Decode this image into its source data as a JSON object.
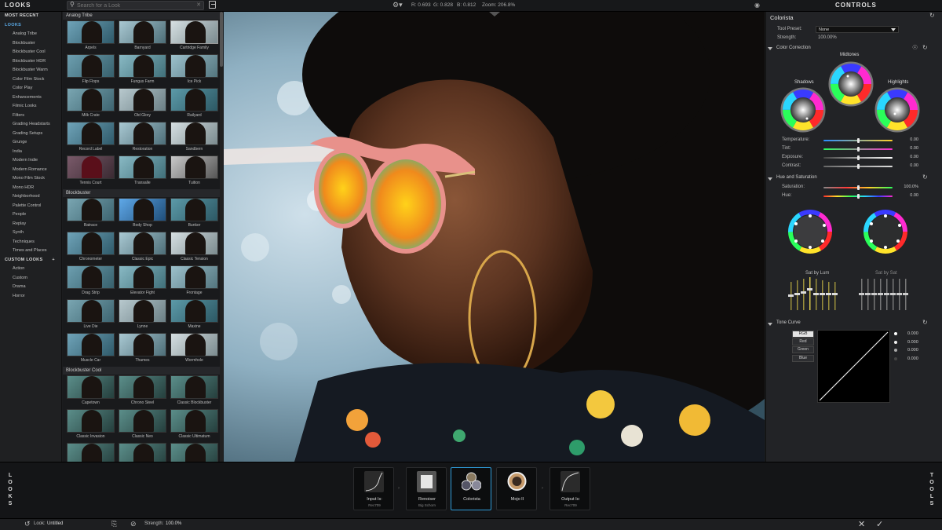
{
  "topbar": {
    "looks_title": "LOOKS",
    "search_placeholder": "Search for a Look",
    "readout_r": "R: 0.693",
    "readout_g": "G: 0.828",
    "readout_b": "B: 0.812",
    "zoom": "Zoom: 206.8%",
    "controls_title": "CONTROLS"
  },
  "sidebar": {
    "sections": [
      {
        "label": "MOST RECENT",
        "active": false,
        "items": []
      },
      {
        "label": "LOOKS",
        "active": true,
        "items": [
          "Analog Tribe",
          "Blockbuster",
          "Blockbuster Cool",
          "Blockbuster HDR",
          "Blockbuster Warm",
          "Color Film Stock",
          "Color Play",
          "Enhancements",
          "Filmic Looks",
          "Filters",
          "Grading Headstarts",
          "Grading Setups",
          "Grunge",
          "India",
          "Modern Indie",
          "Modern Romance",
          "Mono Film Stock",
          "Mono HDR",
          "Neighborhood",
          "Palette Control",
          "People",
          "Replay",
          "Synth",
          "Techniques",
          "Times and Places"
        ]
      },
      {
        "label": "CUSTOM LOOKS",
        "active": false,
        "plus": "+",
        "items": [
          "Action",
          "Custom",
          "Drama",
          "Horror"
        ]
      }
    ]
  },
  "grid": {
    "groups": [
      {
        "title": "Analog Tribe",
        "rows": [
          [
            "Arpels",
            "Barnyard",
            "Cartridge Family"
          ],
          [
            "Flip Flops",
            "Fungus Farm",
            "Ice Pick"
          ],
          [
            "Milk Crate",
            "Old Glory",
            "Railyard"
          ],
          [
            "Record Label",
            "Restoration",
            "Sandbern"
          ],
          [
            "Tennis Court",
            "Transalle",
            "Tuition"
          ]
        ]
      },
      {
        "title": "Blockbuster",
        "rows": [
          [
            "Batrace",
            "Body Shop",
            "Bunker"
          ],
          [
            "Chronometer",
            "Classic Epic",
            "Classic Tension"
          ],
          [
            "Drag Strip",
            "Elevator Fight",
            "Frontage"
          ],
          [
            "Live Die",
            "Lynne",
            "Maxine"
          ],
          [
            "Muscle Car",
            "Thames",
            "Wormhole"
          ]
        ]
      },
      {
        "title": "Blockbuster Cool",
        "rows": [
          [
            "Capetown",
            "Chrono Steel",
            "Classic Blockbuster"
          ],
          [
            "Classic Invasion",
            "Classic Neo",
            "Classic Ultimatum"
          ],
          [
            "",
            "",
            ""
          ]
        ]
      }
    ]
  },
  "panel": {
    "tool_name": "Colorista",
    "tool_preset_label": "Tool Preset:",
    "tool_preset_value": "None",
    "strength_label": "Strength:",
    "strength_value": "100.00%",
    "color_correction": "Color Correction",
    "midtones": "Midtones",
    "shadows": "Shadows",
    "highlights": "Highlights",
    "sliders": [
      {
        "label": "Temperature:",
        "value": "0.00",
        "level": 0.5
      },
      {
        "label": "Tint:",
        "value": "0.00",
        "level": 0.5
      },
      {
        "label": "Exposure:",
        "value": "0.00",
        "level": 0.5
      },
      {
        "label": "Contrast:",
        "value": "0.00",
        "level": 0.5
      }
    ],
    "hue_saturation": "Hue and Saturation",
    "hs_sliders": [
      {
        "label": "Saturation:",
        "value": "100.0%",
        "level": 0.5
      },
      {
        "label": "Hue:",
        "value": "0.00",
        "level": 0.5
      }
    ],
    "sat_by_lum": "Sat by Lum",
    "sat_by_sat": "Sat by Sat",
    "tone_curve": "Tone Curve",
    "curve_channels": [
      "RGB",
      "Red",
      "Green",
      "Blue"
    ],
    "curve_values": [
      "0.000",
      "0.000",
      "0.000",
      "0.000"
    ]
  },
  "dock": {
    "left_label": "LOOKS",
    "right_label": "TOOLS",
    "tools": [
      {
        "name": "Input Is:",
        "sub": "Rec709",
        "active": false
      },
      {
        "name": "Renoiser",
        "sub": "Big Schorn",
        "active": false
      },
      {
        "name": "Colorista",
        "sub": "",
        "active": true
      },
      {
        "name": "Mojo II",
        "sub": "",
        "active": false
      },
      {
        "name": "Output Is:",
        "sub": "Rec709",
        "active": false
      }
    ]
  },
  "statusbar": {
    "look_label": "Look:",
    "look_value": "Untitled",
    "strength_label": "Strength:",
    "strength_value": "100.0%"
  },
  "colors": {
    "accent": "#2f9bd8",
    "sidebar_active": "#5aa9e6"
  }
}
